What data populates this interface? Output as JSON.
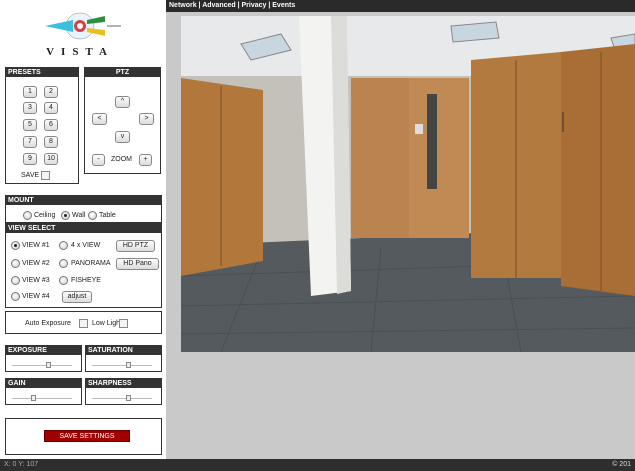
{
  "logo": {
    "text": "VISTA"
  },
  "topbar": {
    "links": "Network | Advanced | Privacy | Events"
  },
  "presets": {
    "title": "PRESETS",
    "buttons": [
      "1",
      "2",
      "3",
      "4",
      "5",
      "6",
      "7",
      "8",
      "9",
      "10"
    ],
    "save_label": "SAVE"
  },
  "ptz": {
    "title": "PTZ",
    "up": "^",
    "left": "<",
    "right": ">",
    "down": "v",
    "zoom_out": "-",
    "zoom_label": "ZOOM",
    "zoom_in": "+"
  },
  "mount": {
    "title": "MOUNT",
    "options": [
      "Ceiling",
      "Wall",
      "Table"
    ],
    "selected": "Wall"
  },
  "view_select": {
    "title": "VIEW SELECT",
    "views": [
      "VIEW #1",
      "VIEW #2",
      "VIEW #3",
      "VIEW #4"
    ],
    "modes": [
      "4 x VIEW",
      "PANORAMA",
      "FISHEYE"
    ],
    "selected": "VIEW #1",
    "hd_ptz": "HD PTZ",
    "hd_pano": "HD Pano",
    "adjust": "adjust"
  },
  "options": {
    "auto_exposure": "Auto Exposure",
    "low_light": "Low Light"
  },
  "image_controls": {
    "exposure": {
      "label": "EXPOSURE",
      "level": 0.6
    },
    "saturation": {
      "label": "SATURATION",
      "level": 0.6
    },
    "gain": {
      "label": "GAIN",
      "level": 0.35
    },
    "sharpness": {
      "label": "SHARPNESS",
      "level": 0.6
    }
  },
  "save_settings": "SAVE SETTINGS",
  "status": {
    "coords": "X: 0 Y: 107",
    "copyright": "© 201"
  },
  "colors": {
    "save_button": "#a00000",
    "header_bg": "#333333"
  }
}
